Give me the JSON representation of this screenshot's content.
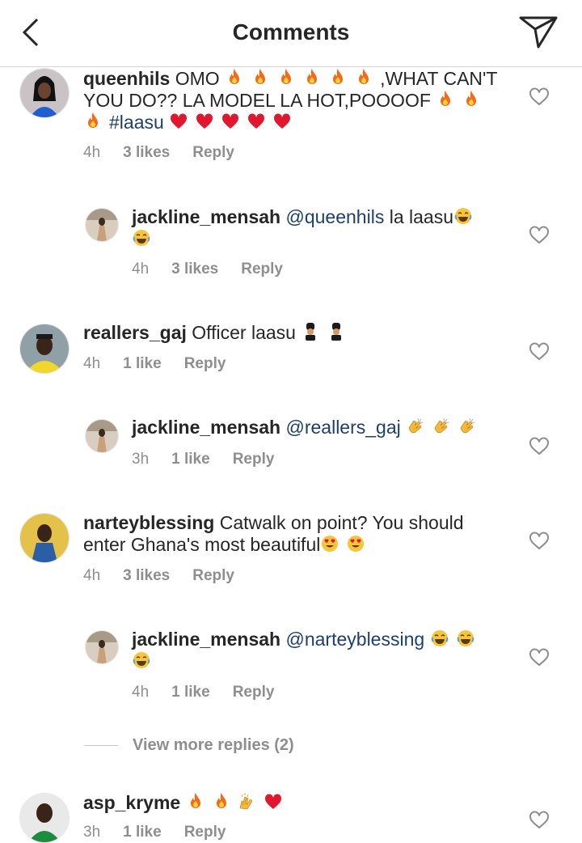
{
  "header": {
    "title": "Comments"
  },
  "comments": [
    {
      "user": "queenhils",
      "text_a": "OMO",
      "text_b": ",WHAT CAN'T YOU DO?? LA MODEL LA HOT,POOOOF",
      "hashtag": "#laasu",
      "time": "4h",
      "likes": "3 likes",
      "reply": "Reply"
    },
    {
      "user": "jackline_mensah",
      "mention": "@queenhils",
      "text": "la laasu",
      "time": "4h",
      "likes": "3 likes",
      "reply": "Reply"
    },
    {
      "user": "reallers_gaj",
      "text": "Officer laasu",
      "time": "4h",
      "likes": "1 like",
      "reply": "Reply"
    },
    {
      "user": "jackline_mensah",
      "mention": "@reallers_gaj",
      "time": "3h",
      "likes": "1 like",
      "reply": "Reply"
    },
    {
      "user": "narteyblessing",
      "text": "Catwalk on point? You should enter Ghana's most beautiful",
      "time": "4h",
      "likes": "3 likes",
      "reply": "Reply"
    },
    {
      "user": "jackline_mensah",
      "mention": "@narteyblessing",
      "time": "4h",
      "likes": "1 like",
      "reply": "Reply"
    },
    {
      "user": "asp_kryme",
      "time": "3h",
      "likes": "1 like",
      "reply": "Reply"
    }
  ],
  "view_more": "View more replies (2)",
  "colors": {
    "text": "#262626",
    "meta": "#8e8e8e",
    "mention": "#1c3f6e",
    "fire": "#f26b1d",
    "heart": "#e0182f"
  }
}
